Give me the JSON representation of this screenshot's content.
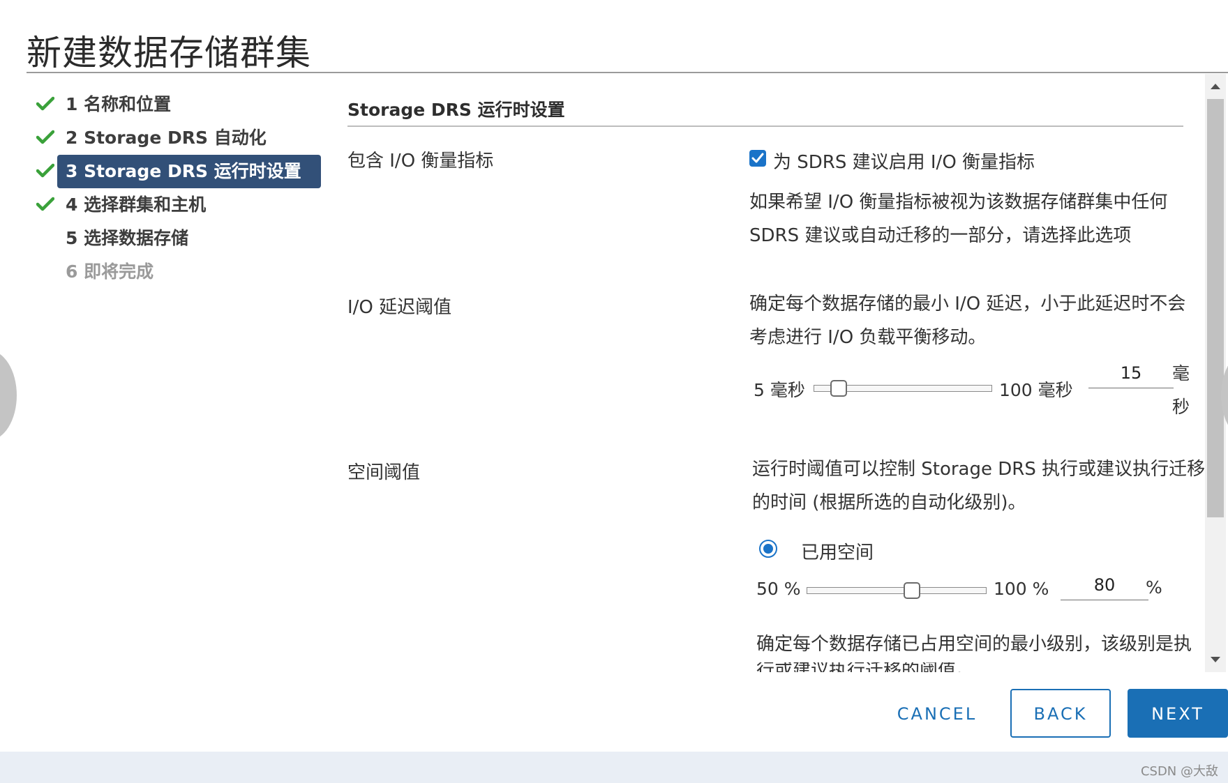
{
  "dialog": {
    "title": "新建数据存储群集"
  },
  "steps": [
    {
      "label": "1 名称和位置",
      "state": "done",
      "icon": "check-icon"
    },
    {
      "label": "2 Storage DRS 自动化",
      "state": "done",
      "icon": "check-icon"
    },
    {
      "label": "3 Storage DRS 运行时设置",
      "state": "active",
      "icon": "check-icon"
    },
    {
      "label": "4 选择群集和主机",
      "state": "done",
      "icon": "check-icon"
    },
    {
      "label": "5 选择数据存储",
      "state": "pending"
    },
    {
      "label": "6 即将完成",
      "state": "disabled"
    }
  ],
  "section": {
    "title": "Storage DRS 运行时设置",
    "io_metric": {
      "label": "包含 I/O 衡量指标",
      "checkbox_label": "为 SDRS 建议启用 I/O 衡量指标",
      "checked": true,
      "desc_line1": "如果希望 I/O 衡量指标被视为该数据存储群集中任何",
      "desc_line2": "SDRS 建议或自动迁移的一部分，请选择此选项"
    },
    "io_latency": {
      "label": "I/O 延迟阈值",
      "desc_line1": "确定每个数据存储的最小 I/O 延迟，小于此延迟时不会",
      "desc_line2": "考虑进行 I/O 负载平衡移动。",
      "min_label": "5 毫秒",
      "max_label": "100 毫秒",
      "min": 5,
      "max": 100,
      "value": "15",
      "unit_line1": "毫",
      "unit_line2": "秒"
    },
    "space": {
      "label": "空间阈值",
      "desc_line1": "运行时阈值可以控制 Storage DRS 执行或建议执行迁移",
      "desc_line2": "的时间 (根据所选的自动化级别)。",
      "radio_label": "已用空间",
      "radio_selected": true,
      "min_label": "50 %",
      "max_label": "100 %",
      "min": 50,
      "max": 100,
      "value": "80",
      "unit": "%",
      "desc2_line1": "确定每个数据存储已占用空间的最小级别，该级别是执",
      "desc2_line2": "行或建议执行迁移的阈值。"
    }
  },
  "footer": {
    "cancel": "CANCEL",
    "back": "BACK",
    "next": "NEXT"
  },
  "watermark": "CSDN @大敌",
  "colors": {
    "accent": "#1a6fb5",
    "active_step": "#325078",
    "check": "#3aa13a"
  }
}
